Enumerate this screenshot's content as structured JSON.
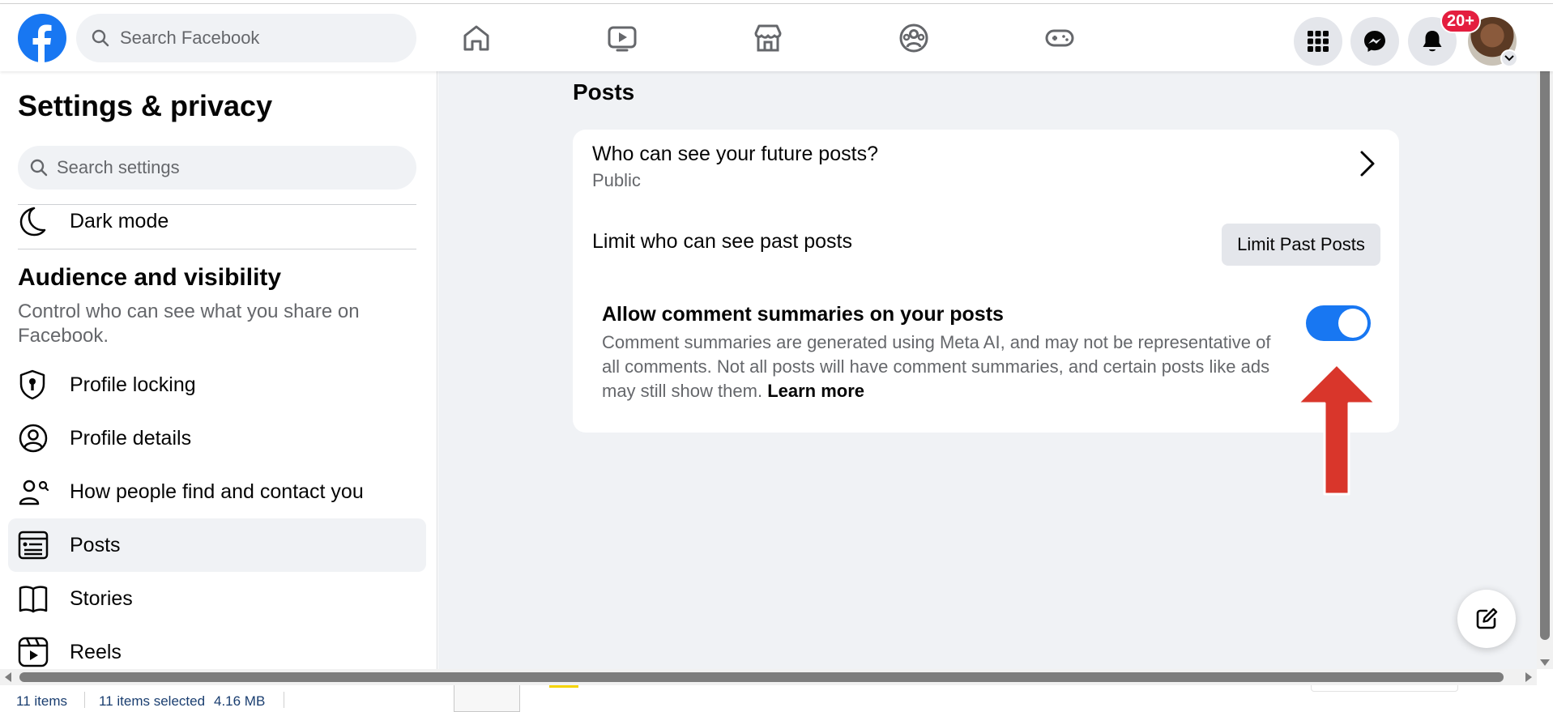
{
  "topbar": {
    "search_placeholder": "Search Facebook",
    "nav_icons": [
      "home-icon",
      "video-icon",
      "marketplace-icon",
      "groups-icon",
      "gaming-icon"
    ],
    "right_icons": [
      "menu-grid-icon",
      "messenger-icon",
      "bell-icon"
    ],
    "notification_badge": "20+",
    "brand_color": "#1877f2"
  },
  "sidebar": {
    "title": "Settings & privacy",
    "search_placeholder": "Search settings",
    "dark_mode_label": "Dark mode",
    "section_title": "Audience and visibility",
    "section_desc": "Control who can see what you share on Facebook.",
    "items": [
      {
        "label": "Profile locking",
        "icon": "profile-lock-icon"
      },
      {
        "label": "Profile details",
        "icon": "profile-icon"
      },
      {
        "label": "How people find and contact you",
        "icon": "find-contact-icon"
      },
      {
        "label": "Posts",
        "icon": "posts-icon",
        "active": true
      },
      {
        "label": "Stories",
        "icon": "book-icon"
      },
      {
        "label": "Reels",
        "icon": "reels-icon"
      }
    ]
  },
  "main": {
    "title": "Posts",
    "future_posts_question": "Who can see your future posts?",
    "future_posts_value": "Public",
    "limit_past_label": "Limit who can see past posts",
    "limit_past_button": "Limit Past Posts",
    "comment_summaries_label": "Allow comment summaries on your posts",
    "comment_summaries_desc": "Comment summaries are generated using Meta AI, and may not be representative of all comments. Not all posts will have comment summaries, and certain posts like ads may still show them.",
    "learn_more": "Learn more",
    "comment_summaries_enabled": true,
    "annotation_arrow_color": "#d9362b"
  },
  "statusbar": {
    "items_count": "11 items",
    "selected": "11 items selected",
    "size": "4.16 MB"
  }
}
